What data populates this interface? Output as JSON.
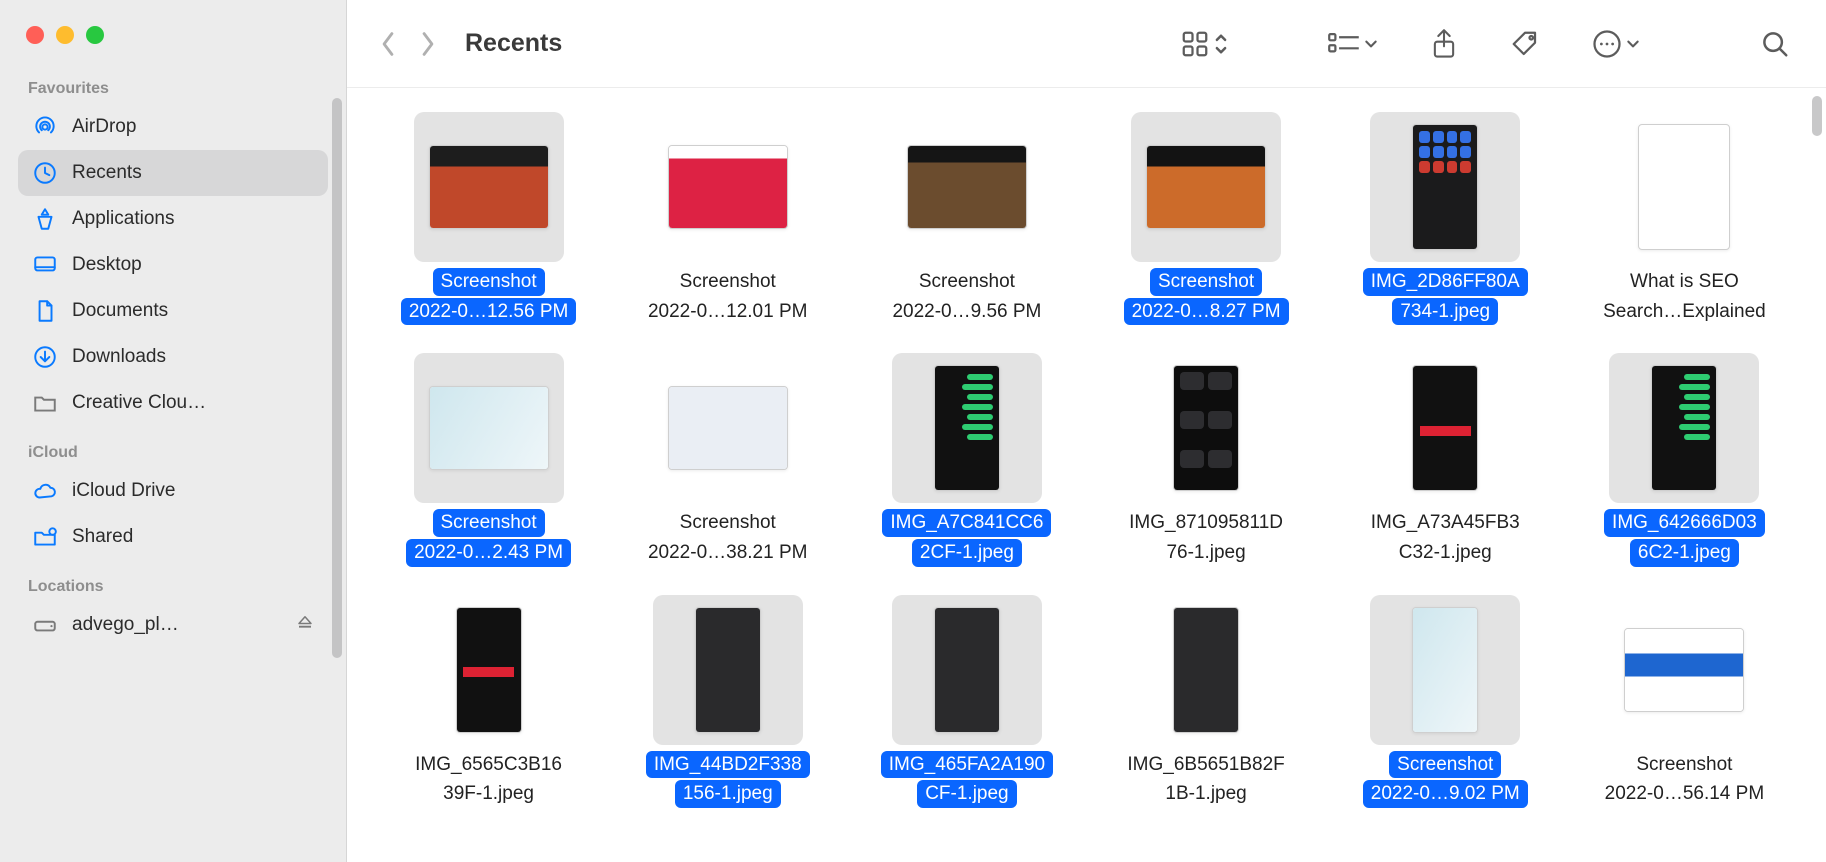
{
  "colors": {
    "accent": "#0a66ff"
  },
  "header": {
    "title": "Recents"
  },
  "sidebar": {
    "sections": [
      {
        "label": "Favourites",
        "items": [
          {
            "name": "airdrop",
            "label": "AirDrop",
            "icon": "airdrop-icon",
            "active": false
          },
          {
            "name": "recents",
            "label": "Recents",
            "icon": "clock-icon",
            "active": true
          },
          {
            "name": "apps",
            "label": "Applications",
            "icon": "apps-icon",
            "active": false
          },
          {
            "name": "desktop",
            "label": "Desktop",
            "icon": "desktop-icon",
            "active": false
          },
          {
            "name": "documents",
            "label": "Documents",
            "icon": "document-icon",
            "active": false
          },
          {
            "name": "downloads",
            "label": "Downloads",
            "icon": "download-icon",
            "active": false
          },
          {
            "name": "cc",
            "label": "Creative Clou…",
            "icon": "folder-icon",
            "active": false
          }
        ]
      },
      {
        "label": "iCloud",
        "items": [
          {
            "name": "iclouddrive",
            "label": "iCloud Drive",
            "icon": "cloud-icon",
            "active": false
          },
          {
            "name": "shared",
            "label": "Shared",
            "icon": "shared-icon",
            "active": false
          }
        ]
      },
      {
        "label": "Locations",
        "items": [
          {
            "name": "advego",
            "label": "advego_pl…",
            "icon": "disk-icon",
            "active": false,
            "eject": true
          }
        ]
      }
    ]
  },
  "files": [
    {
      "selected": true,
      "shape": "landscape",
      "thumb": "color1",
      "line1": "Screenshot",
      "line2": "2022-0…12.56 PM"
    },
    {
      "selected": false,
      "shape": "landscape",
      "thumb": "color2",
      "line1": "Screenshot",
      "line2": "2022-0…12.01 PM"
    },
    {
      "selected": false,
      "shape": "landscape",
      "thumb": "rest",
      "line1": "Screenshot",
      "line2": "2022-0…9.56 PM"
    },
    {
      "selected": true,
      "shape": "landscape",
      "thumb": "dumpling",
      "line1": "Screenshot",
      "line2": "2022-0…8.27 PM"
    },
    {
      "selected": true,
      "shape": "portrait",
      "thumb": "ios",
      "line1": "IMG_2D86FF80A",
      "line2": "734-1.jpeg"
    },
    {
      "selected": false,
      "shape": "doc",
      "thumb": "doc",
      "line1": "What is SEO",
      "line2": "Search…Explained"
    },
    {
      "selected": true,
      "shape": "landscape",
      "thumb": "map",
      "line1": "Screenshot",
      "line2": "2022-0…2.43 PM"
    },
    {
      "selected": false,
      "shape": "landscape",
      "thumb": "light",
      "line1": "Screenshot",
      "line2": "2022-0…38.21 PM"
    },
    {
      "selected": true,
      "shape": "portrait",
      "thumb": "toggles",
      "line1": "IMG_A7C841CC6",
      "line2": "2CF-1.jpeg"
    },
    {
      "selected": false,
      "shape": "portrait",
      "thumb": "controlc",
      "line1": "IMG_871095811D",
      "line2": "76-1.jpeg"
    },
    {
      "selected": false,
      "shape": "portrait",
      "thumb": "redline",
      "line1": "IMG_A73A45FB3",
      "line2": "C32-1.jpeg"
    },
    {
      "selected": true,
      "shape": "portrait",
      "thumb": "toggles",
      "line1": "IMG_642666D03",
      "line2": "6C2-1.jpeg"
    },
    {
      "selected": false,
      "shape": "portrait",
      "thumb": "redline",
      "line1": "IMG_6565C3B16",
      "line2": "39F-1.jpeg"
    },
    {
      "selected": true,
      "shape": "portrait",
      "thumb": "dark",
      "line1": "IMG_44BD2F338",
      "line2": "156-1.jpeg"
    },
    {
      "selected": true,
      "shape": "portrait",
      "thumb": "dark",
      "line1": "IMG_465FA2A190",
      "line2": "CF-1.jpeg"
    },
    {
      "selected": false,
      "shape": "portrait",
      "thumb": "dark",
      "line1": "IMG_6B5651B82F",
      "line2": "1B-1.jpeg"
    },
    {
      "selected": true,
      "shape": "portrait",
      "thumb": "map",
      "line1": "Screenshot",
      "line2": "2022-0…9.02 PM"
    },
    {
      "selected": false,
      "shape": "landscape",
      "thumb": "webblue",
      "line1": "Screenshot",
      "line2": "2022-0…56.14 PM"
    }
  ]
}
